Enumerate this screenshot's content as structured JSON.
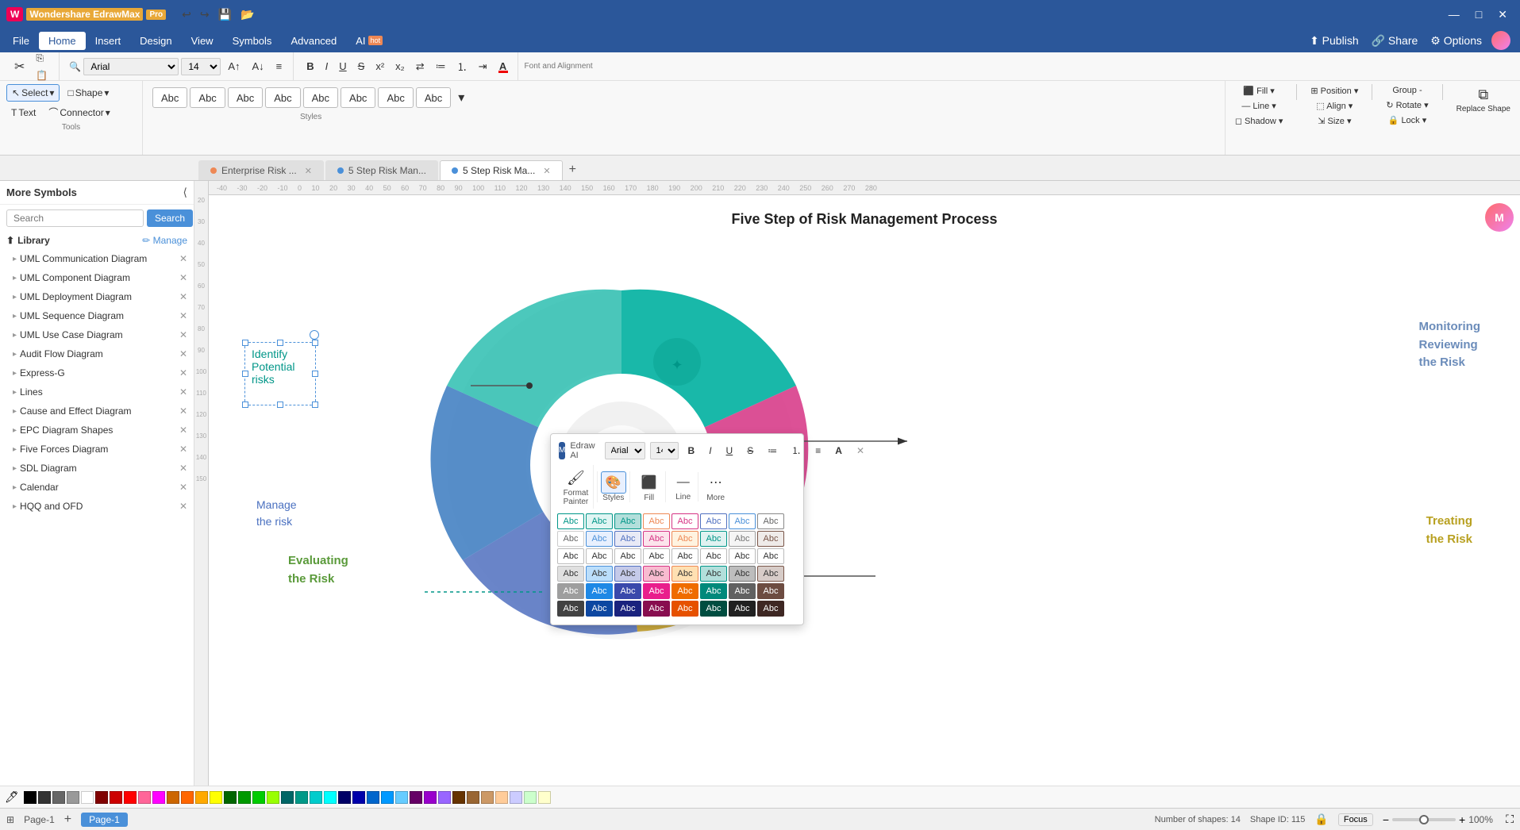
{
  "app": {
    "title": "Wondershare EdrawMax",
    "tier_label": "Pro"
  },
  "titlebar": {
    "undo_label": "↩",
    "redo_label": "↪",
    "save_label": "💾",
    "open_label": "📂",
    "minimize": "—",
    "maximize": "□",
    "close": "✕"
  },
  "menubar": {
    "items": [
      "File",
      "Home",
      "Insert",
      "Design",
      "View",
      "Symbols",
      "Advanced",
      "AI hot"
    ]
  },
  "toolbar": {
    "font_name": "Arial",
    "font_size": "14",
    "select_label": "Select",
    "shape_label": "Shape",
    "text_label": "Text",
    "connector_label": "Connector",
    "fill_label": "Fill",
    "line_label": "Line",
    "shadow_label": "Shadow",
    "position_label": "Position",
    "group_label": "Group -",
    "rotate_label": "Rotate",
    "align_label": "Align",
    "size_label": "Size",
    "lock_label": "Lock",
    "replace_shape_label": "Replace Shape",
    "styles_label": "Styles",
    "abc_buttons": [
      "Abc",
      "Abc",
      "Abc",
      "Abc",
      "Abc",
      "Abc",
      "Abc",
      "Abc"
    ]
  },
  "tabs": [
    {
      "label": "Enterprise Risk ...",
      "active": false,
      "modified": true,
      "dot_color": "#e85"
    },
    {
      "label": "5 Step Risk Man...",
      "active": false,
      "modified": false,
      "dot_color": "#4a90d9"
    },
    {
      "label": "5 Step Risk Ma...",
      "active": true,
      "modified": false,
      "dot_color": "#4a90d9"
    }
  ],
  "sidebar": {
    "title": "More Symbols",
    "search_placeholder": "Search",
    "search_button": "Search",
    "library_label": "Library",
    "manage_label": "Manage",
    "items": [
      "UML Communication Diagram",
      "UML Component Diagram",
      "UML Deployment Diagram",
      "UML Sequence Diagram",
      "UML Use Case Diagram",
      "Audit Flow Diagram",
      "Express-G",
      "Lines",
      "Cause and Effect Diagram",
      "EPC Diagram Shapes",
      "Five Forces Diagram",
      "SDL Diagram",
      "Calendar",
      "HQQ and OFD"
    ]
  },
  "canvas": {
    "diagram_title": "Five Step of Risk Management Process",
    "selected_text": "Identify\nPotential\nrisks",
    "label_monitoring": "Monitoring\nReviewing\nthe Risk",
    "label_treating": "Treating\nthe Risk",
    "label_evaluating": "Evaluating\nthe Risk"
  },
  "style_picker": {
    "font_name": "Arial",
    "font_size": "14",
    "bold": "B",
    "italic": "I",
    "underline": "U",
    "strikethrough": "S",
    "format_painter_label": "Format\nPainter",
    "styles_label": "Styles",
    "fill_label": "Fill",
    "line_label": "Line",
    "more_label": "More",
    "style_rows": [
      [
        "Abc",
        "Abc",
        "Abc",
        "Abc",
        "Abc",
        "Abc",
        "Abc",
        "Abc"
      ],
      [
        "Abc",
        "Abc",
        "Abc",
        "Abc",
        "Abc",
        "Abc",
        "Abc",
        "Abc"
      ],
      [
        "Abc",
        "Abc",
        "Abc",
        "Abc",
        "Abc",
        "Abc",
        "Abc",
        "Abc"
      ],
      [
        "Abc",
        "Abc",
        "Abc",
        "Abc",
        "Abc",
        "Abc",
        "Abc",
        "Abc"
      ],
      [
        "Abc",
        "Abc",
        "Abc",
        "Abc",
        "Abc",
        "Abc",
        "Abc",
        "Abc"
      ],
      [
        "Abc",
        "Abc",
        "Abc",
        "Abc",
        "Abc",
        "Abc",
        "Abc",
        "Abc"
      ]
    ]
  },
  "statusbar": {
    "shapes_label": "Number of shapes: 14",
    "shape_id_label": "Shape ID: 115",
    "focus_label": "Focus",
    "zoom_label": "100%",
    "page_label": "Page-1"
  }
}
